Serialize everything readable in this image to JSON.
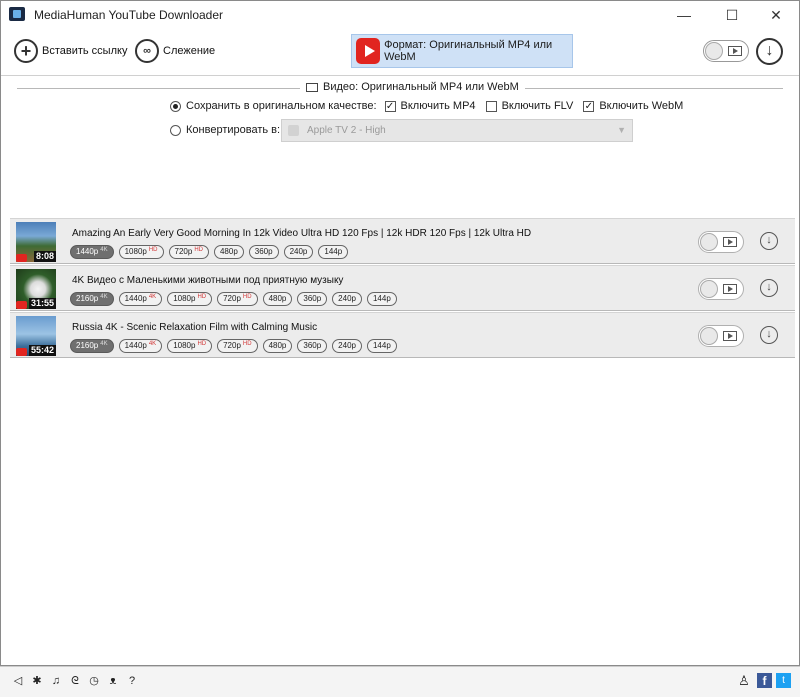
{
  "window": {
    "title": "MediaHuman YouTube Downloader",
    "controls": {
      "minimize": "—",
      "maximize": "☐",
      "close": "✕"
    }
  },
  "toolbar": {
    "paste_label": "Вставить ссылку",
    "tracking_label": "Слежение",
    "format_label": "Формат: Оригинальный MP4 или WebM"
  },
  "settings": {
    "section_title": "Видео: Оригинальный MP4 или WebM",
    "save_original_label": "Сохранить в оригинальном качестве:",
    "save_original_selected": true,
    "include_mp4_label": "Включить MP4",
    "include_mp4_checked": true,
    "include_flv_label": "Включить FLV",
    "include_flv_checked": false,
    "include_webm_label": "Включить WebM",
    "include_webm_checked": true,
    "convert_label": "Конвертировать в:",
    "convert_selected": false,
    "convert_value": "Apple TV 2 - High"
  },
  "items": [
    {
      "title": "Amazing An Early Very Good Morning In 12k Video Ultra HD 120 Fps | 12k HDR 120 Fps | 12k Ultra HD",
      "duration": "8:08",
      "qualities": [
        {
          "label": "1440p",
          "tag": "4K",
          "selected": true
        },
        {
          "label": "1080p",
          "tag": "HD",
          "selected": false
        },
        {
          "label": "720p",
          "tag": "HD",
          "selected": false
        },
        {
          "label": "480p",
          "tag": "",
          "selected": false
        },
        {
          "label": "360p",
          "tag": "",
          "selected": false
        },
        {
          "label": "240p",
          "tag": "",
          "selected": false
        },
        {
          "label": "144p",
          "tag": "",
          "selected": false
        }
      ]
    },
    {
      "title": "4K Видео с Маленькими животными под приятную музыку",
      "duration": "31:55",
      "qualities": [
        {
          "label": "2160p",
          "tag": "4K",
          "selected": true
        },
        {
          "label": "1440p",
          "tag": "4K",
          "selected": false
        },
        {
          "label": "1080p",
          "tag": "HD",
          "selected": false
        },
        {
          "label": "720p",
          "tag": "HD",
          "selected": false
        },
        {
          "label": "480p",
          "tag": "",
          "selected": false
        },
        {
          "label": "360p",
          "tag": "",
          "selected": false
        },
        {
          "label": "240p",
          "tag": "",
          "selected": false
        },
        {
          "label": "144p",
          "tag": "",
          "selected": false
        }
      ]
    },
    {
      "title": "Russia 4K - Scenic Relaxation Film with Calming Music",
      "duration": "55:42",
      "qualities": [
        {
          "label": "2160p",
          "tag": "4K",
          "selected": true
        },
        {
          "label": "1440p",
          "tag": "4K",
          "selected": false
        },
        {
          "label": "1080p",
          "tag": "HD",
          "selected": false
        },
        {
          "label": "720p",
          "tag": "HD",
          "selected": false
        },
        {
          "label": "480p",
          "tag": "",
          "selected": false
        },
        {
          "label": "360p",
          "tag": "",
          "selected": false
        },
        {
          "label": "240p",
          "tag": "",
          "selected": false
        },
        {
          "label": "144p",
          "tag": "",
          "selected": false
        }
      ]
    }
  ],
  "bottom_icons": [
    "send-icon",
    "gear-icon",
    "music-icon",
    "snail-icon",
    "clock-icon",
    "binoculars-icon",
    "help-icon"
  ],
  "bottom_glyphs": [
    "◁",
    "✱",
    "♫",
    "ᘓ",
    "◷",
    "ᴥ",
    "?"
  ],
  "social": {
    "facebook": "f",
    "twitter": "t"
  },
  "colors": {
    "format_highlight": "#cfe1f6",
    "youtube_red": "#e12520",
    "selected_badge": "#6f6f6f"
  }
}
